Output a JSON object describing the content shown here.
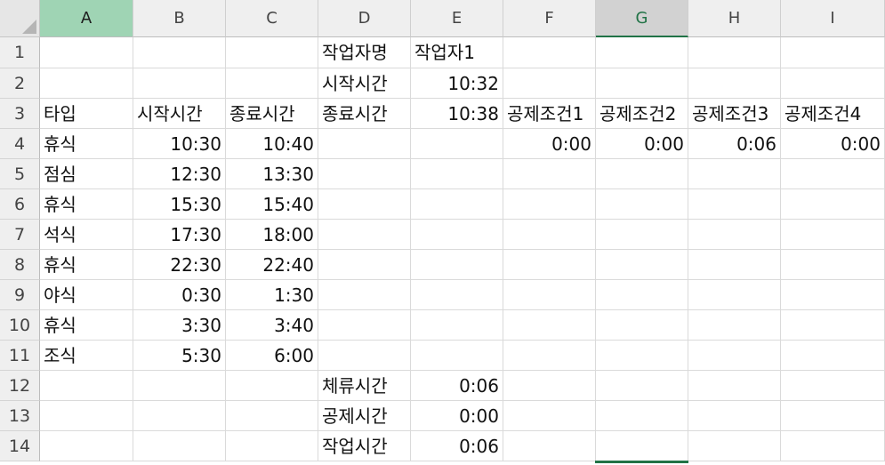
{
  "columns": [
    "A",
    "B",
    "C",
    "D",
    "E",
    "F",
    "G",
    "H",
    "I"
  ],
  "rows": [
    "1",
    "2",
    "3",
    "4",
    "5",
    "6",
    "7",
    "8",
    "9",
    "10",
    "11",
    "12",
    "13",
    "14"
  ],
  "cells": {
    "D1": "작업자명",
    "E1": "작업자1",
    "D2": "시작시간",
    "E2": "10:32",
    "A3": "타입",
    "B3": "시작시간",
    "C3": "종료시간",
    "D3": "종료시간",
    "E3": "10:38",
    "F3": "공제조건1",
    "G3": "공제조건2",
    "H3": "공제조건3",
    "I3": "공제조건4",
    "A4": "휴식",
    "B4": "10:30",
    "C4": "10:40",
    "F4": "0:00",
    "G4": "0:00",
    "H4": "0:06",
    "I4": "0:00",
    "A5": "점심",
    "B5": "12:30",
    "C5": "13:30",
    "A6": "휴식",
    "B6": "15:30",
    "C6": "15:40",
    "A7": "석식",
    "B7": "17:30",
    "C7": "18:00",
    "A8": "휴식",
    "B8": "22:30",
    "C8": "22:40",
    "A9": "야식",
    "B9": "0:30",
    "C9": "1:30",
    "A10": "휴식",
    "B10": "3:30",
    "C10": "3:40",
    "A11": "조식",
    "B11": "5:30",
    "C11": "6:00",
    "D12": "체류시간",
    "E12": "0:06",
    "D13": "공제시간",
    "E13": "0:00",
    "D14": "작업시간",
    "E14": "0:06"
  },
  "selection": {
    "active_column": "G",
    "highlighted_column": "A"
  },
  "colors": {
    "accent": "#217346",
    "header_bg": "#efefef",
    "selected_header": "#9fd4b4",
    "gridline": "#dadada"
  }
}
